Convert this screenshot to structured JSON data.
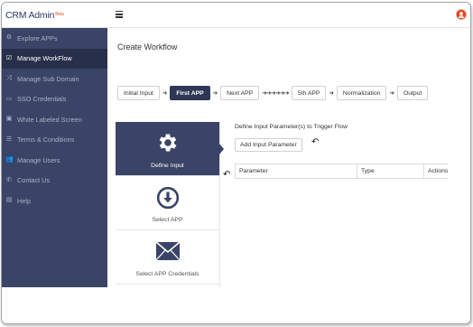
{
  "app": {
    "brand": "CRM Admin",
    "brand_badge": "Beta"
  },
  "sidebar": {
    "items": [
      {
        "label": "Explore APPs",
        "icon": "cogs-icon",
        "active": false
      },
      {
        "label": "Manage WorkFlow",
        "icon": "check-square-icon",
        "active": true
      },
      {
        "label": "Manage Sub Domain",
        "icon": "shuffle-icon",
        "active": false
      },
      {
        "label": "SSO Credentials",
        "icon": "monitor-icon",
        "active": false
      },
      {
        "label": "White Labeled Screen",
        "icon": "image-icon",
        "active": false
      },
      {
        "label": "Terms & Conditions",
        "icon": "list-icon",
        "active": false
      },
      {
        "label": "Manage Users",
        "icon": "users-icon",
        "active": false
      },
      {
        "label": "Contact Us",
        "icon": "phone-icon",
        "active": false
      },
      {
        "label": "Help",
        "icon": "file-icon",
        "active": false
      }
    ]
  },
  "page": {
    "title": "Create Workflow"
  },
  "steps": {
    "initial_input": "Initial Input",
    "first_app": "First APP",
    "next_app": "Next APP",
    "fifth_app": "5th APP",
    "normalization": "Normalization",
    "output": "Output"
  },
  "tiles": {
    "define_input": "Define Input",
    "select_app": "Select APP",
    "select_credentials": "Select APP Credentials"
  },
  "define_input": {
    "heading": "Define Input Parameter(s) to Trigger Flow",
    "add_button": "Add Input Parameter",
    "columns": [
      "Parameter",
      "Type",
      "Actions"
    ]
  },
  "colors": {
    "sidebar": "#3a4466",
    "sidebar_active": "#272f4a",
    "accent": "#2e3755",
    "avatar": "#e0401e"
  }
}
